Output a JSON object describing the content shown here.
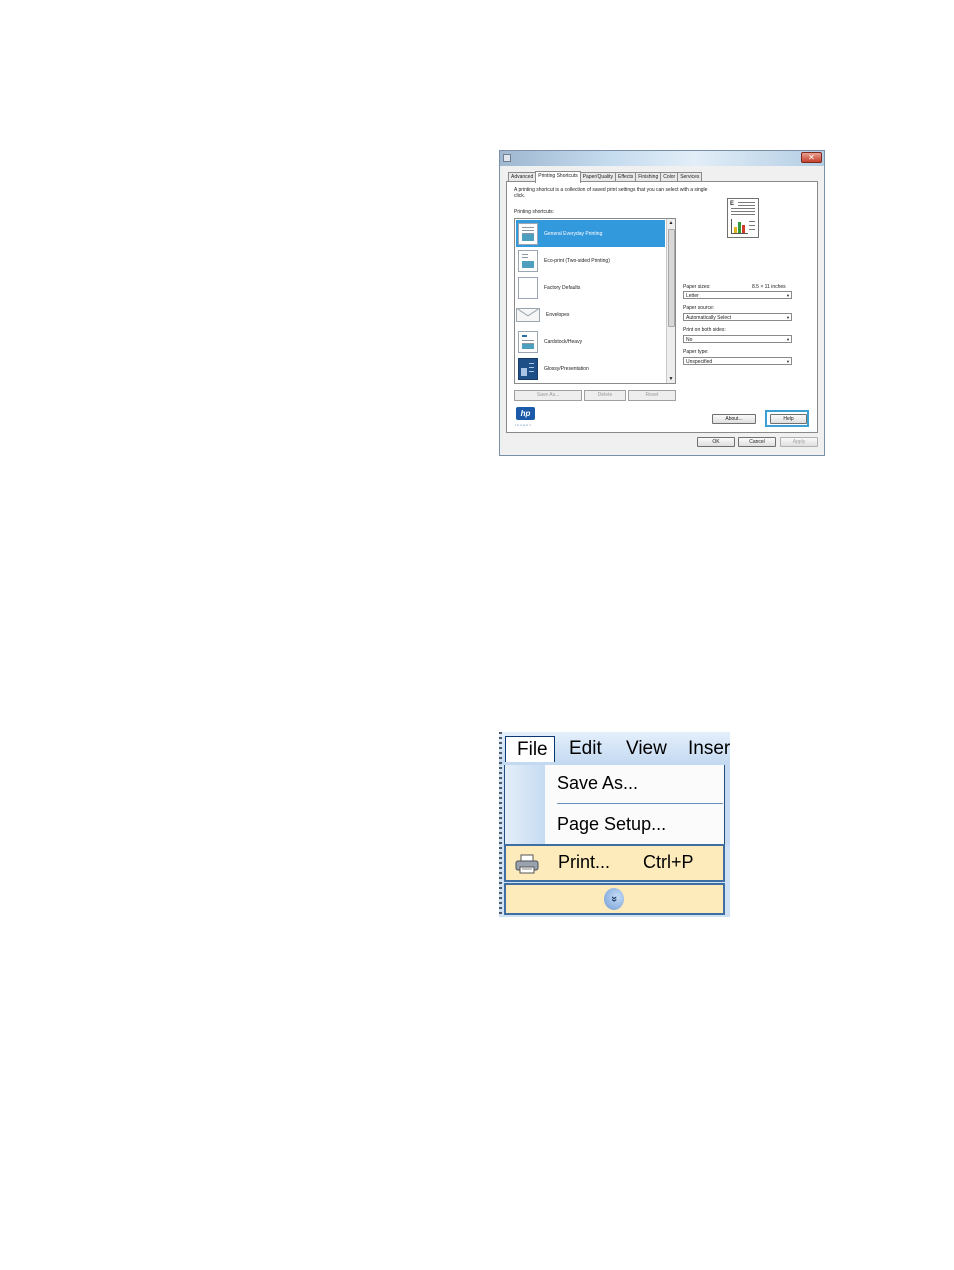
{
  "dialog": {
    "close_symbol": "✕",
    "tabs": [
      {
        "label": "Advanced"
      },
      {
        "label": "Printing Shortcuts"
      },
      {
        "label": "Paper/Quality"
      },
      {
        "label": "Effects"
      },
      {
        "label": "Finishing"
      },
      {
        "label": "Color"
      },
      {
        "label": "Services"
      }
    ],
    "active_tab": "Printing Shortcuts",
    "description": "A printing shortcut is a collection of saved print settings that you can select with a single click.",
    "shortcuts_label": "Printing shortcuts:",
    "shortcuts": [
      {
        "label": "General Everyday Printing",
        "icon": "document-icon"
      },
      {
        "label": "Eco-print (Two-sided Printing)",
        "icon": "two-sided-document-icon"
      },
      {
        "label": "Factory Defaults",
        "icon": "blank-page-icon"
      },
      {
        "label": "Envelopes",
        "icon": "envelope-icon"
      },
      {
        "label": "Cardstock/Heavy",
        "icon": "cardstock-icon"
      },
      {
        "label": "Glossy/Presentation",
        "icon": "glossy-presentation-icon"
      }
    ],
    "selected_shortcut": "General Everyday Printing",
    "list_buttons": {
      "save_as": "Save As...",
      "delete": "Delete",
      "reset": "Reset"
    },
    "paper_sizes_label": "Paper sizes:",
    "paper_sizes_value": "8.5 × 11 inches",
    "paper_size": "Letter",
    "paper_source_label": "Paper source:",
    "paper_source": "Automatically Select",
    "both_sides_label": "Print on both sides:",
    "both_sides": "No",
    "paper_type_label": "Paper type:",
    "paper_type": "Unspecified",
    "combo_arrow": "▼",
    "scroll_up": "▲",
    "scroll_down": "▼",
    "logo_text": "hp",
    "logo_tagline": "invent",
    "about_label": "About...",
    "help_label": "Help",
    "ok_label": "OK",
    "cancel_label": "Cancel",
    "apply_label": "Apply",
    "colors": {
      "selection": "#3399dd",
      "highlight": "#3aa0d4",
      "hp_blue": "#1a5aa8"
    }
  },
  "menu": {
    "bar": [
      "File",
      "Edit",
      "View",
      "Inser"
    ],
    "items": {
      "save_as": "Save As...",
      "page_setup": "Page Setup...",
      "print": "Print...",
      "print_shortcut": "Ctrl+P"
    },
    "expand_symbol": "»",
    "colors": {
      "hover": "#fdebbc",
      "hover_border": "#3f6ea3"
    }
  }
}
